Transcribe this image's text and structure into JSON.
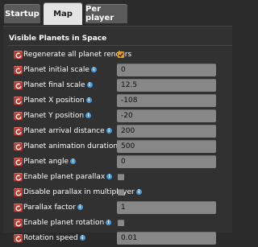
{
  "tabs": [
    {
      "label": "Startup",
      "active": false
    },
    {
      "label": "Map",
      "active": true
    },
    {
      "label": "Per player",
      "active": false
    }
  ],
  "section": {
    "title": "Visible Planets in Space"
  },
  "settings": [
    {
      "label": "Regenerate all planet renders",
      "type": "checkbox",
      "checked": true,
      "info": false
    },
    {
      "label": "Planet initial scale",
      "type": "number",
      "value": "0",
      "info": true
    },
    {
      "label": "Planet final scale",
      "type": "number",
      "value": "12.5",
      "info": true
    },
    {
      "label": "Planet X position",
      "type": "number",
      "value": "-108",
      "info": true
    },
    {
      "label": "Planet Y position",
      "type": "number",
      "value": "-20",
      "info": true
    },
    {
      "label": "Planet arrival distance",
      "type": "number",
      "value": "200",
      "info": true
    },
    {
      "label": "Planet animation duration",
      "type": "number",
      "value": "500",
      "info": true
    },
    {
      "label": "Planet angle",
      "type": "number",
      "value": "0",
      "info": true
    },
    {
      "label": "Enable planet parallax",
      "type": "checkbox",
      "checked": false,
      "info": true
    },
    {
      "label": "Disable parallax in multiplayer",
      "type": "checkbox",
      "checked": false,
      "info": true
    },
    {
      "label": "Parallax factor",
      "type": "number",
      "value": "1",
      "info": true
    },
    {
      "label": "Enable planet rotation",
      "type": "checkbox",
      "checked": false,
      "info": true
    },
    {
      "label": "Rotation speed",
      "type": "number",
      "value": "0.01",
      "info": true
    }
  ],
  "colors": {
    "reset": "#c23b32",
    "info": "#4e9ad8",
    "checked": "#e59a22"
  },
  "icons": {
    "reset": "reset-icon",
    "info": "info-icon",
    "check": "checkmark-icon"
  }
}
